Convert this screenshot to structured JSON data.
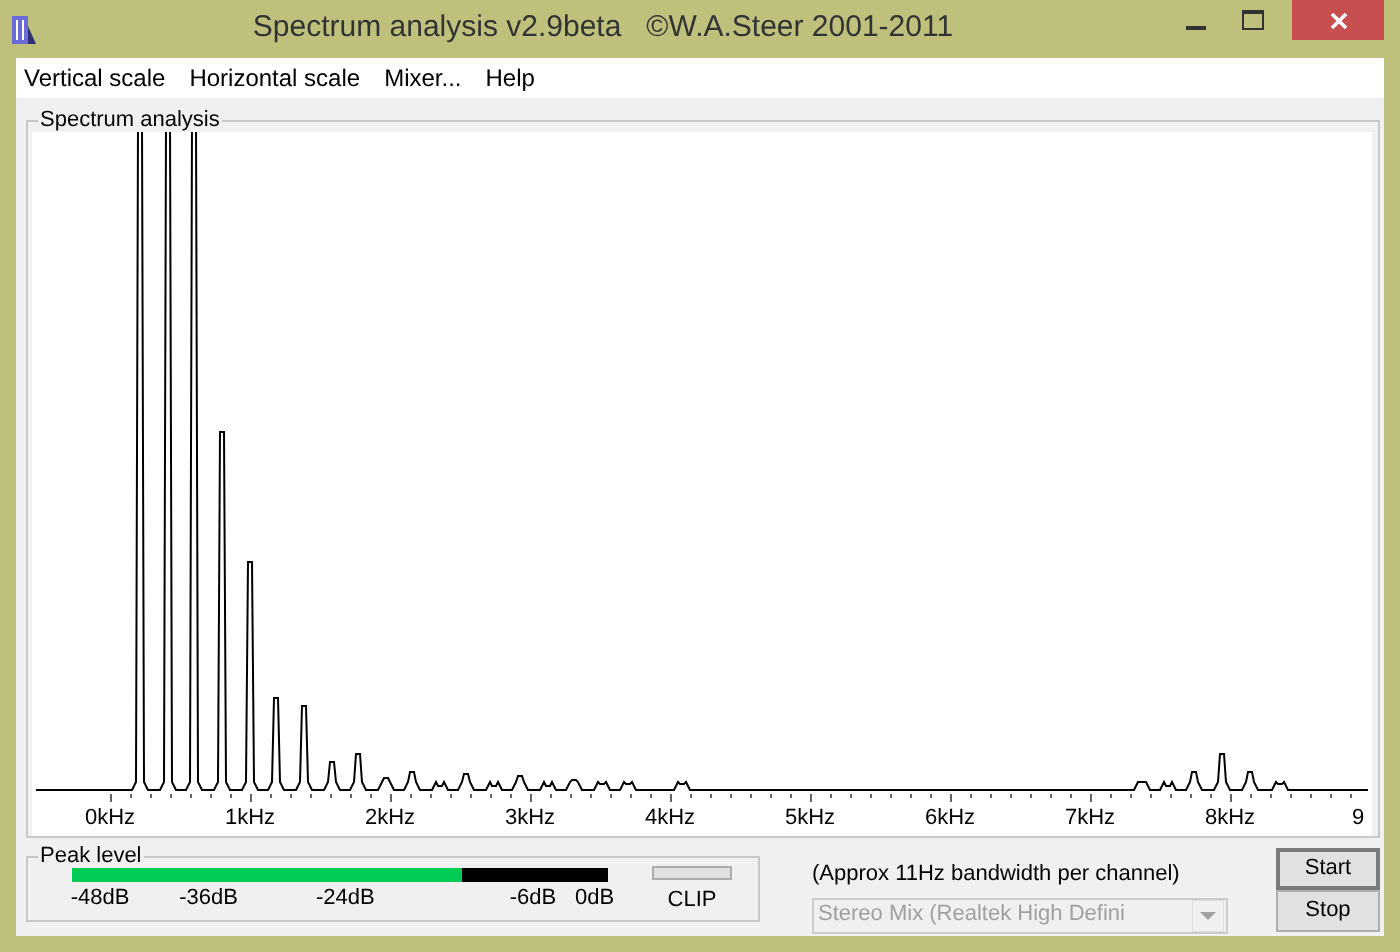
{
  "window": {
    "title": "Spectrum analysis v2.9beta   ©W.A.Steer 2001-2011"
  },
  "menu": [
    {
      "label": "Vertical scale"
    },
    {
      "label": "Horizontal scale"
    },
    {
      "label": "Mixer..."
    },
    {
      "label": "Help"
    }
  ],
  "spectrum": {
    "title": "Spectrum analysis",
    "x_axis_labels": [
      "0kHz",
      "1kHz",
      "2kHz",
      "3kHz",
      "4kHz",
      "5kHz",
      "6kHz",
      "7kHz",
      "8kHz",
      "9"
    ]
  },
  "peak_level": {
    "title": "Peak level",
    "level": 0.727,
    "scale": [
      "-48dB",
      "-36dB",
      "-24dB",
      "-6dB",
      "0dB"
    ],
    "clip": {
      "label": "CLIP",
      "on": false
    }
  },
  "bandwidth_note": "(Approx 11Hz bandwidth per channel)",
  "input_device": {
    "value": "Stereo Mix (Realtek High Defini",
    "disabled": true
  },
  "buttons": [
    {
      "label": "Start",
      "default": true
    },
    {
      "label": "Stop",
      "default": false
    }
  ]
}
